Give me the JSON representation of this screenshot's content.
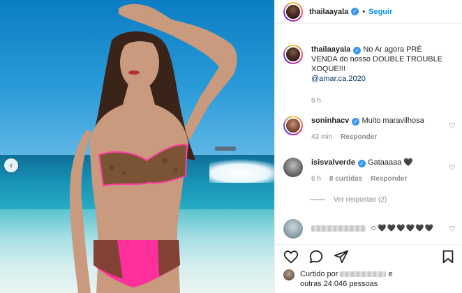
{
  "header": {
    "username": "thailaayala",
    "verified_symbol": "✓",
    "separator": "•",
    "follow_label": "Seguir"
  },
  "media": {
    "prev_symbol": "‹"
  },
  "caption": {
    "username": "thailaayala",
    "text": "No Ar agora PRÉ VENDA do nosso DOUBLE TROUBLE XOQUE!!!",
    "mention": "@amar.ca.2020",
    "time": "6 h"
  },
  "comments": [
    {
      "username": "soninhacv",
      "text": "Muito maravilhosa",
      "time": "43 min",
      "reply_label": "Responder",
      "likes_label": ""
    },
    {
      "username": "isisvalverde",
      "text": "Gataaaaa 🖤",
      "time": "6 h",
      "likes_label": "8 curtidas",
      "reply_label": "Responder"
    },
    {
      "username": "",
      "text": "☺🖤🖤🖤🖤🖤🖤",
      "time": "",
      "reply_label": "",
      "likes_label": ""
    }
  ],
  "view_replies": "Ver respostas (2)",
  "actions": {
    "icons": [
      "heart-icon",
      "comment-icon",
      "share-icon",
      "bookmark-icon"
    ]
  },
  "likes": {
    "prefix": "Curtido por",
    "connector": "e",
    "rest": "outras 24.046 pessoas"
  },
  "colors": {
    "link": "#0095f6",
    "verified": "#3897f0",
    "muted": "#8e8e8e",
    "bikini_pink": "#ff2f9b"
  }
}
